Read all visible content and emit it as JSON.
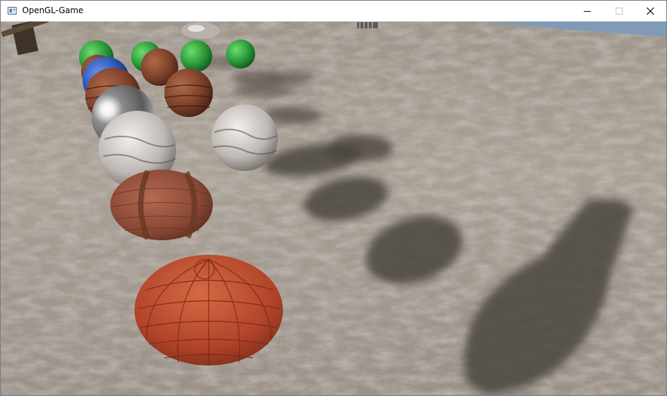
{
  "window": {
    "title": "OpenGL-Game",
    "icon": "app-window-icon",
    "controls": [
      "minimize-icon",
      "maximize-icon",
      "close-icon"
    ]
  },
  "scene": {
    "ground": "sand",
    "sky_color": "#7f9bb6",
    "sand_color": "#a89f95",
    "shadow_color": "#4a443e",
    "spheres": [
      {
        "material": "grass",
        "color": "#2f9e3a"
      },
      {
        "material": "grass",
        "color": "#2f9e3a"
      },
      {
        "material": "grass",
        "color": "#2f9e3a"
      },
      {
        "material": "grass",
        "color": "#2f9e3a"
      },
      {
        "material": "wood",
        "color": "#7a4530"
      },
      {
        "material": "wood",
        "color": "#7a4530"
      },
      {
        "material": "blue-granite",
        "color": "#2d55b8"
      },
      {
        "material": "wood",
        "color": "#8a4a32"
      },
      {
        "material": "wood",
        "color": "#8a4a32"
      },
      {
        "material": "chrome",
        "color": "#9a9a9a"
      },
      {
        "material": "marble",
        "color": "#c8c4c0"
      },
      {
        "material": "marble",
        "color": "#c8c4c0"
      },
      {
        "material": "brick",
        "color": "#8e4a38"
      },
      {
        "material": "roof-tiles",
        "color": "#b0452a"
      }
    ],
    "objects": [
      "rock",
      "wooden-structure",
      "fence"
    ]
  }
}
